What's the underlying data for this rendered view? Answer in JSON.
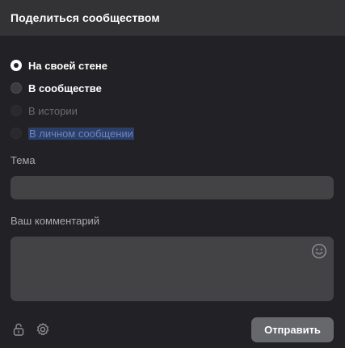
{
  "dialog": {
    "title": "Поделиться сообществом"
  },
  "share_options": [
    {
      "label": "На своей стене",
      "state": "checked"
    },
    {
      "label": "В сообществе",
      "state": "unchecked"
    },
    {
      "label": "В истории",
      "state": "disabled"
    },
    {
      "label": "В личном сообщении",
      "state": "disabled-highlighted"
    }
  ],
  "topic": {
    "label": "Тема",
    "value": "",
    "placeholder": ""
  },
  "comment": {
    "label": "Ваш комментарий",
    "value": "",
    "placeholder": ""
  },
  "icons": {
    "emoji": "smile-icon",
    "privacy": "lock-icon",
    "settings": "gear-icon"
  },
  "footer": {
    "send_label": "Отправить"
  },
  "colors": {
    "background": "#222226",
    "header": "#333335",
    "field": "#434346",
    "button": "#67686c",
    "selection": "#2b3f6a"
  }
}
